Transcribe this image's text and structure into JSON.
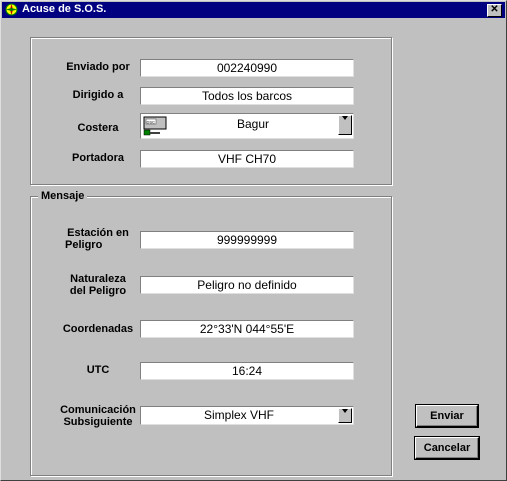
{
  "window": {
    "title": "Acuse de S.O.S.",
    "close_label": "✕"
  },
  "top_group": {
    "enviado_por": {
      "label": "Enviado por",
      "value": "002240990"
    },
    "dirigido_a": {
      "label": "Dirigido a",
      "value": "Todos los barcos"
    },
    "costera": {
      "label": "Costera",
      "value": "Bagur",
      "icon": "dsc-station-icon"
    },
    "portadora": {
      "label": "Portadora",
      "value": "VHF CH70"
    }
  },
  "mensaje_group": {
    "legend": "Mensaje",
    "estacion": {
      "label_line1": "Estación en",
      "label_line2": "Peligro",
      "value": "999999999"
    },
    "naturaleza": {
      "label_line1": "Naturaleza",
      "label_line2": "del Peligro",
      "value": "Peligro no definido"
    },
    "coordenadas": {
      "label": "Coordenadas",
      "value": "22°33'N 044°55'E"
    },
    "utc": {
      "label": "UTC",
      "value": "16:24"
    },
    "comunicacion": {
      "label_line1": "Comunicación",
      "label_line2": "Subsiguiente",
      "value": "Simplex VHF"
    }
  },
  "buttons": {
    "enviar": "Enviar",
    "cancelar": "Cancelar"
  },
  "colors": {
    "titlebar": "#000080",
    "face": "#c0c0c0"
  }
}
